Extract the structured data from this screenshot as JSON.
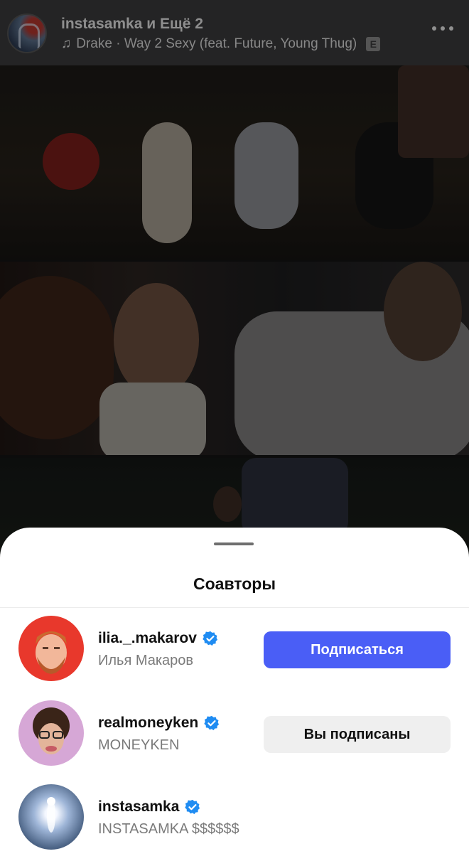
{
  "post_header": {
    "title": "instasamka и Ещё 2",
    "music": "Drake · Way 2 Sexy (feat. Future, Young Thug)",
    "explicit_badge": "E",
    "more_icon": "more-horizontal-icon"
  },
  "sheet": {
    "title": "Соавторы",
    "coauthors": [
      {
        "username": "ilia._.makarov",
        "name": "Илья Макаров",
        "verified": true,
        "button_label": "Подписаться",
        "button_state": "follow"
      },
      {
        "username": "realmoneyken",
        "name": "MONEYKEN",
        "verified": true,
        "button_label": "Вы подписаны",
        "button_state": "following"
      },
      {
        "username": "instasamka",
        "name": "INSTASAMKA $$$$$$",
        "verified": true
      }
    ]
  },
  "colors": {
    "follow_button": "#4a5ef6",
    "verified_badge": "#1f8cf2",
    "secondary_text": "#7a7a7a"
  }
}
